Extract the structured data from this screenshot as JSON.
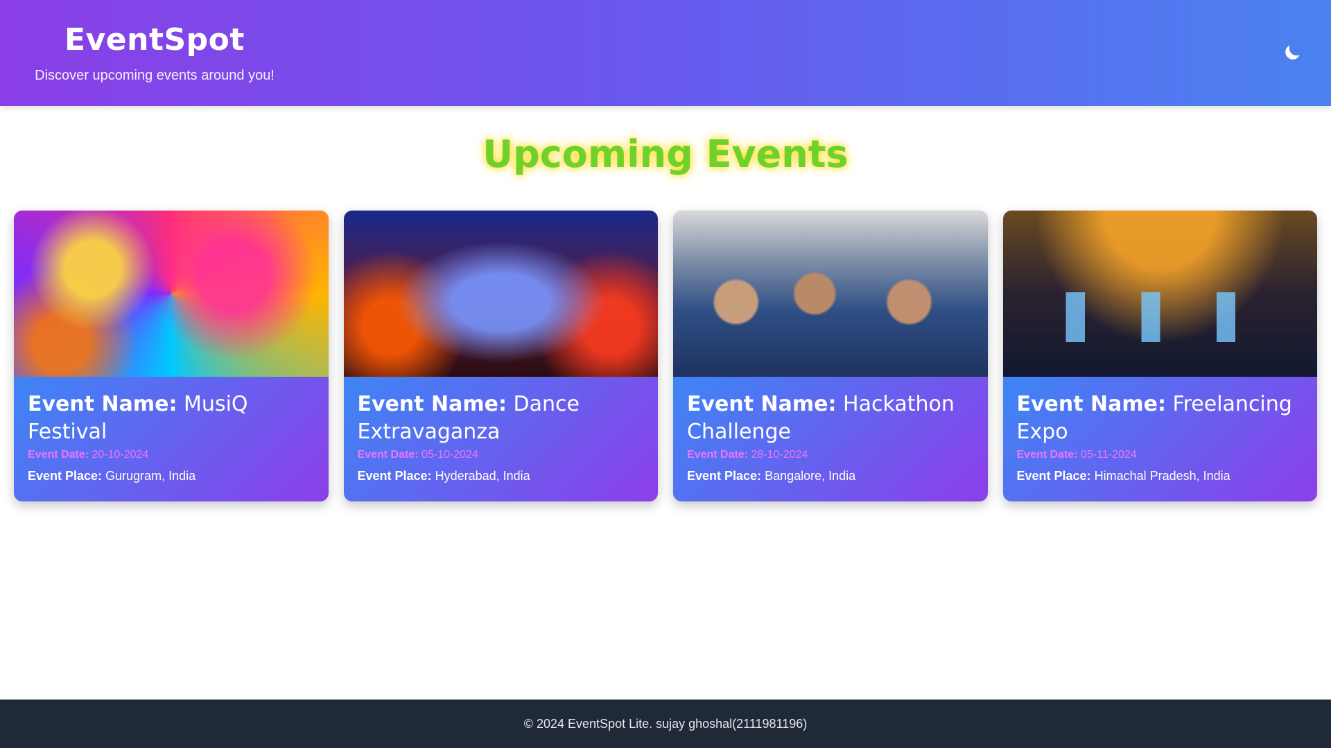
{
  "header": {
    "title": "EventSpot",
    "tagline": "Discover upcoming events around you!",
    "theme_toggle_icon": "moon-icon"
  },
  "section": {
    "title": "Upcoming Events"
  },
  "labels": {
    "name": "Event Name:",
    "date": "Event Date:",
    "place": "Event Place:"
  },
  "events": [
    {
      "name": "MusiQ Festival",
      "date": "20-10-2024",
      "place": "Gurugram, India",
      "image": "musician-guitar-image"
    },
    {
      "name": "Dance Extravaganza",
      "date": "05-10-2024",
      "place": "Hyderabad, India",
      "image": "concert-stage-image"
    },
    {
      "name": "Hackathon Challenge",
      "date": "28-10-2024",
      "place": "Bangalore, India",
      "image": "hackathon-participants-image"
    },
    {
      "name": "Freelancing Expo",
      "date": "05-11-2024",
      "place": "Himachal Pradesh, India",
      "image": "expo-hall-image"
    }
  ],
  "footer": {
    "text": "© 2024 EventSpot Lite. sujay ghoshal(2111981196)"
  },
  "colors": {
    "header_gradient_start": "#8a3fe6",
    "header_gradient_end": "#4a82f0",
    "section_title": "#6fd12c",
    "section_title_glow": "#ffd60a",
    "card_gradient_start": "#3d86f5",
    "card_gradient_end": "#8d3ee8",
    "event_date": "#f074ff",
    "footer_bg": "#1f2937"
  }
}
